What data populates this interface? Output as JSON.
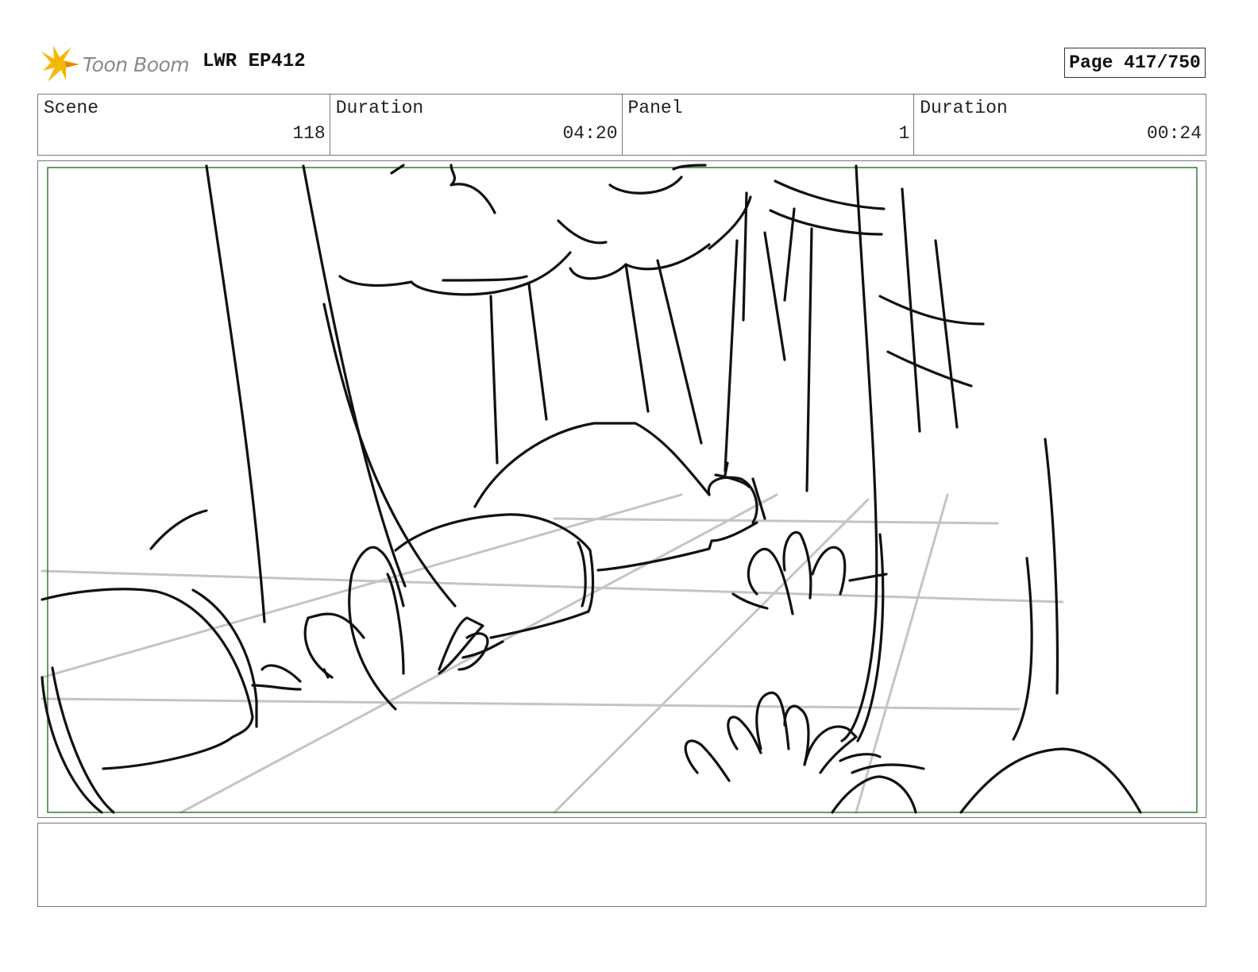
{
  "header": {
    "logo_text": "Toon Boom",
    "logo_icon": "toon-boom-star-icon",
    "project": "LWR EP412",
    "page": "Page 417/750"
  },
  "info": {
    "scene_label": "Scene",
    "scene_value": "118",
    "duration_label": "Duration",
    "duration_value": "04:20",
    "panel_label": "Panel",
    "panel_value": "1",
    "panel_duration_label": "Duration",
    "panel_duration_value": "00:24"
  },
  "colors": {
    "safe_frame": "#2e7d32",
    "sketch": "#111111",
    "perspective_grid": "#c4c4c4",
    "logo_star": "#f5b800"
  },
  "notes": {
    "text": ""
  }
}
